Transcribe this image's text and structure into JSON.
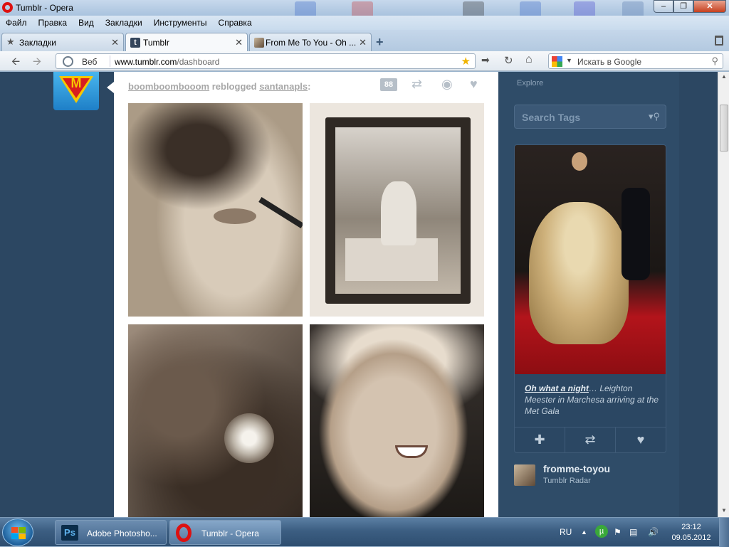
{
  "window": {
    "title": "Tumblr - Opera"
  },
  "menu": [
    "Файл",
    "Правка",
    "Вид",
    "Закладки",
    "Инструменты",
    "Справка"
  ],
  "tabs": [
    {
      "label": "Закладки",
      "icon": "star-icon"
    },
    {
      "label": "Tumblr",
      "icon": "tumblr-icon"
    },
    {
      "label": "From Me To You - Oh ...",
      "icon": "photo-favicon"
    }
  ],
  "address": {
    "mode_label": "Веб",
    "url_host": "www.tumblr.com",
    "url_path": "/dashboard",
    "search_placeholder": "Искать в Google"
  },
  "post": {
    "user": "boomboombooom",
    "action": "reblogged",
    "source": "santanapls",
    "colon": ":",
    "notes_count": "88"
  },
  "sidebar": {
    "explore_label": "Explore",
    "search_tags_placeholder": "Search Tags",
    "radar": {
      "caption_link": "Oh what a night",
      "caption_text": "… Leighton Meester in Marchesa arriving at the Met Gala"
    },
    "radar_blog": {
      "name": "fromme-toyou",
      "subtitle": "Tumblr Radar"
    }
  },
  "taskbar": {
    "items": [
      {
        "label": "Adobe Photosho...",
        "icon": "photoshop-icon"
      },
      {
        "label": "Tumblr - Opera",
        "icon": "opera-icon"
      }
    ],
    "language": "RU",
    "time": "23:12",
    "date": "09.05.2012"
  },
  "colors": {
    "page_background": "#2c4762",
    "accent_red": "#d11111",
    "text_muted": "#a7a7a7"
  }
}
